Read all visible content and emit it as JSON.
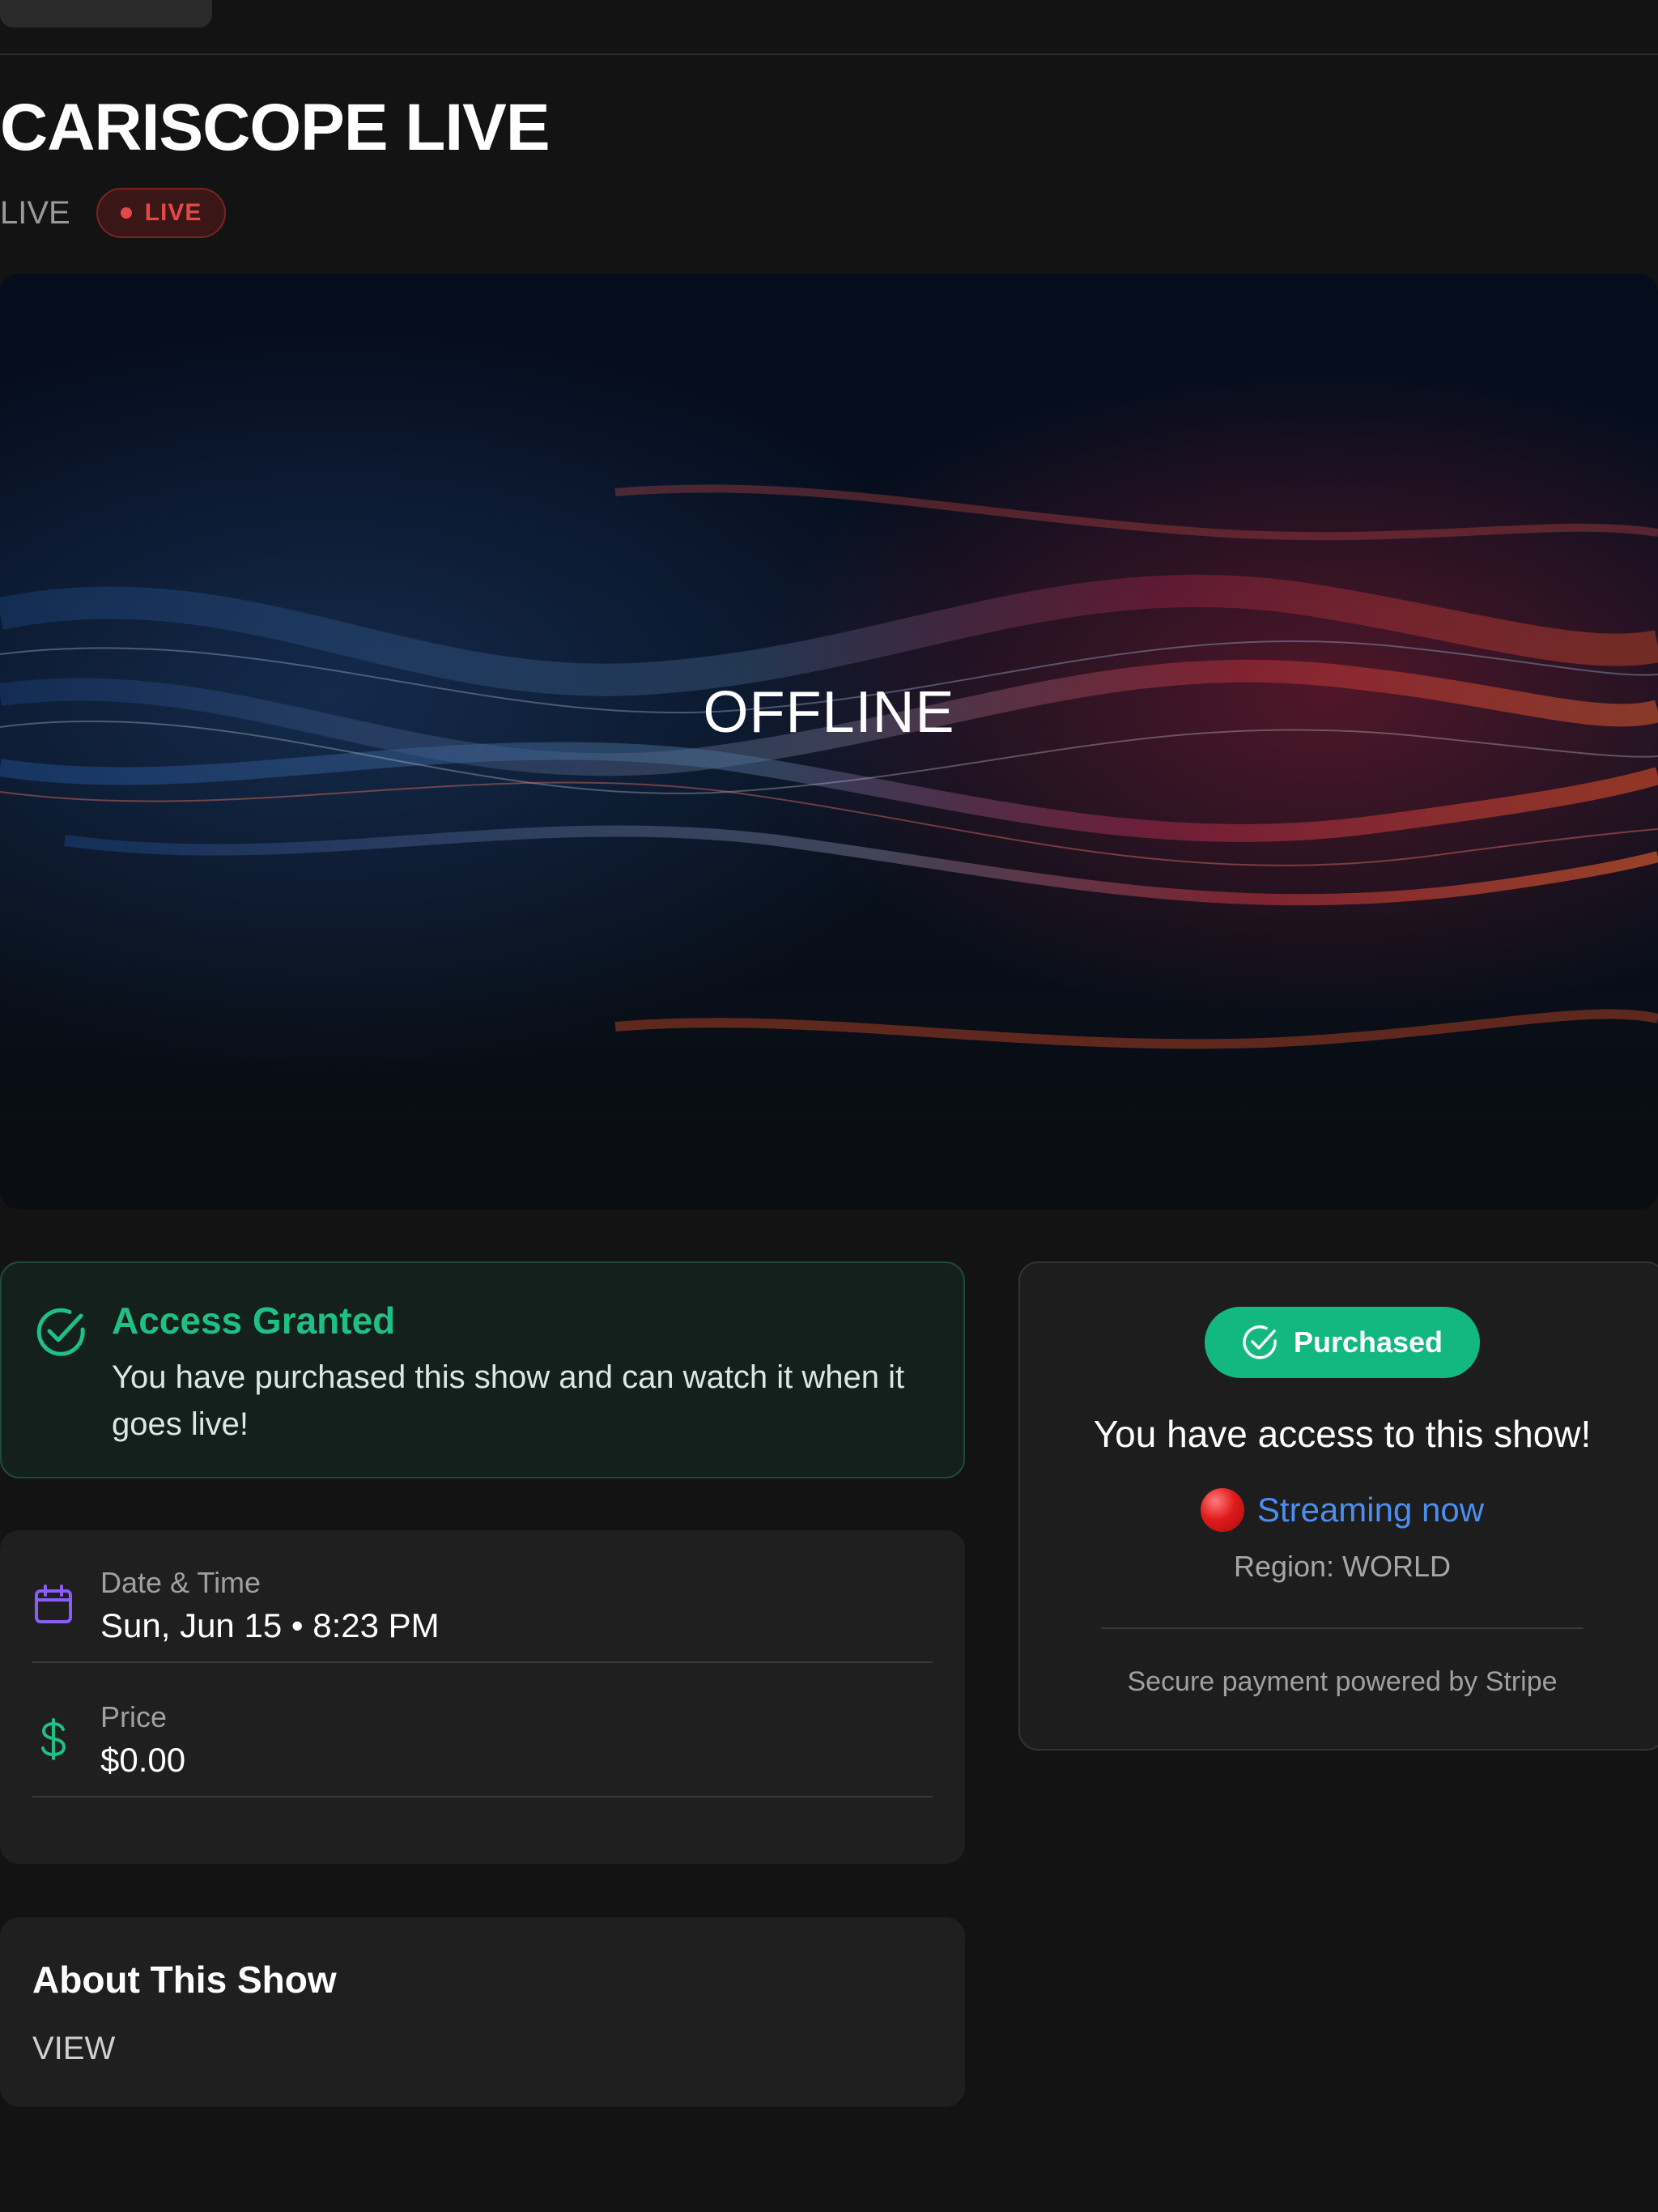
{
  "header": {
    "title": "CARISCOPE LIVE",
    "status_text": "LIVE",
    "badge_label": "LIVE"
  },
  "video": {
    "overlay_text": "OFFLINE"
  },
  "access_notice": {
    "heading": "Access Granted",
    "body": "You have purchased this show and can watch it when it goes live!",
    "icon": "check-circle-icon"
  },
  "details": {
    "date_label": "Date & Time",
    "date_value": "Sun, Jun 15 • 8:23 PM",
    "date_icon": "calendar-icon",
    "price_label": "Price",
    "price_value": "$0.00",
    "price_icon": "dollar-icon"
  },
  "about": {
    "title": "About This Show",
    "body": "VIEW"
  },
  "purchase_panel": {
    "badge_label": "Purchased",
    "access_text": "You have access to this show!",
    "streaming_text": "Streaming now",
    "region_text": "Region: WORLD",
    "payment_text": "Secure payment powered by Stripe"
  },
  "colors": {
    "background": "#131313",
    "accent_green": "#12b880",
    "live_red": "#e24848",
    "link_blue": "#4a8ef0",
    "calendar_purple": "#8b5cf6"
  }
}
